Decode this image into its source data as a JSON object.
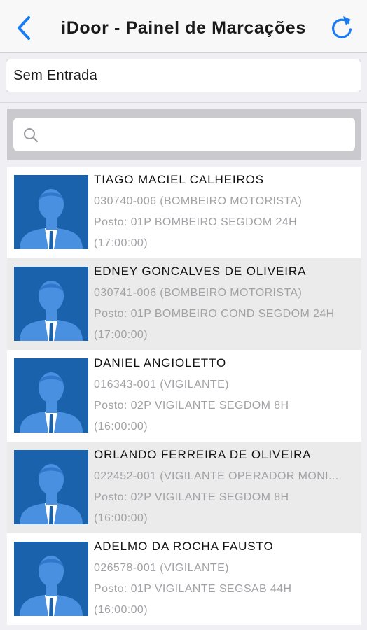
{
  "navbar": {
    "title": "iDoor - Painel de Marcações",
    "back_icon": "chevron-left-icon",
    "refresh_icon": "refresh-icon",
    "accent_color": "#1a7cf5"
  },
  "filter": {
    "value": "Sem Entrada"
  },
  "search": {
    "placeholder": "",
    "icon": "search-icon"
  },
  "employees": [
    {
      "name": "TIAGO MACIEL CALHEIROS",
      "registration": "030740-006 (BOMBEIRO MOTORISTA)",
      "post": "Posto: 01P BOMBEIRO SEGDOM 24H",
      "time": "(17:00:00)"
    },
    {
      "name": "EDNEY GONCALVES DE OLIVEIRA",
      "registration": "030741-006 (BOMBEIRO MOTORISTA)",
      "post": "Posto: 01P BOMBEIRO COND SEGDOM 24H",
      "time": "(17:00:00)"
    },
    {
      "name": "DANIEL ANGIOLETTO",
      "registration": "016343-001 (VIGILANTE)",
      "post": "Posto: 02P VIGILANTE SEGDOM 8H",
      "time": "(16:00:00)"
    },
    {
      "name": "ORLANDO FERREIRA DE OLIVEIRA",
      "registration": "022452-001 (VIGILANTE OPERADOR MONI...",
      "post": "Posto: 02P VIGILANTE SEGDOM 8H",
      "time": "(16:00:00)"
    },
    {
      "name": "ADELMO DA ROCHA FAUSTO",
      "registration": "026578-001 (VIGILANTE)",
      "post": "Posto: 01P VIGILANTE SEGSAB 44H",
      "time": "(16:00:00)"
    }
  ],
  "avatar_icon": "person-avatar-icon",
  "colors": {
    "avatar_background": "#1b62ad",
    "row_alternate": "#ebebeb",
    "secondary_text": "#a2a2a6"
  }
}
